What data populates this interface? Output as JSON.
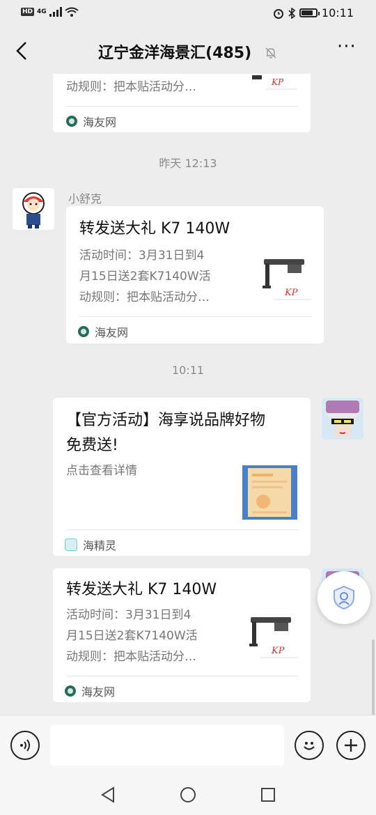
{
  "status_bar": {
    "hd": "HD",
    "network": "4G",
    "time": "10:11"
  },
  "header": {
    "title": "辽宁金洋海景汇(485)",
    "more": "···"
  },
  "messages": [
    {
      "desc_last_line": "动规则：把本贴活动分…",
      "source": "海友网"
    },
    {
      "timestamp": "昨天 12:13"
    },
    {
      "sender": "小舒克",
      "title": "转发送大礼 K7 140W",
      "desc": [
        "活动时间：3月31日到4",
        "月15日送2套K7140W活",
        "动规则：把本贴活动分…"
      ],
      "source": "海友网"
    },
    {
      "timestamp": "10:11"
    },
    {
      "title": [
        "【官方活动】海享说品牌好物",
        "免费送!"
      ],
      "desc": [
        "点击查看详情"
      ],
      "source": "海精灵"
    },
    {
      "title": "转发送大礼 K7 140W",
      "desc": [
        "活动时间：3月31日到4",
        "月15日送2套K7140W活",
        "动规则：把本贴活动分…"
      ],
      "source": "海友网"
    }
  ],
  "input": {
    "placeholder": ""
  },
  "icons": {
    "back": "chevron-left-icon",
    "mute": "bell-slash-icon",
    "voice": "voice-icon",
    "emoji": "emoji-icon",
    "plus": "plus-icon",
    "float": "shield-icon",
    "nav_back": "triangle-back-icon",
    "nav_home": "circle-home-icon",
    "nav_recent": "square-recent-icon"
  },
  "colors": {
    "background": "#ededed",
    "card": "#ffffff",
    "muted_text": "#777777",
    "source_icon": "#2a6a5a"
  }
}
